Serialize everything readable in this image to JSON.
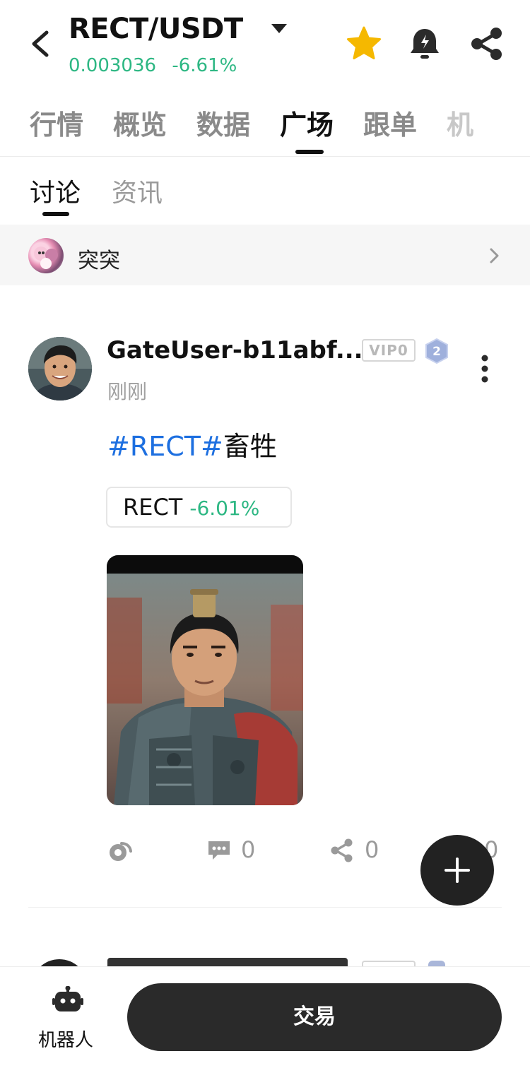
{
  "header": {
    "pair": "RECT/USDT",
    "price": "0.003036",
    "change": "-6.61%"
  },
  "main_tabs": [
    {
      "label": "行情"
    },
    {
      "label": "概览"
    },
    {
      "label": "数据"
    },
    {
      "label": "广场",
      "active": true
    },
    {
      "label": "跟单"
    },
    {
      "label": "机"
    }
  ],
  "sub_tabs": {
    "discuss": "讨论",
    "news": "资讯"
  },
  "topic": {
    "label": "突突"
  },
  "post": {
    "username": "GateUser-b11abf...",
    "vip": "VIP0",
    "level": "2",
    "time": "刚刚",
    "hashtag": "#RECT#",
    "text": "畜牲",
    "coin": {
      "name": "RECT",
      "change": "-6.01%"
    },
    "actions": {
      "comments": "0",
      "shares": "0",
      "likes": "0"
    }
  },
  "bottom": {
    "bot_label": "机器人",
    "trade_label": "交易"
  },
  "colors": {
    "positive_green": "#2db783",
    "hashtag_blue": "#1d6fe0",
    "star_yellow": "#f5b800",
    "dark_button": "#2a2a2a"
  }
}
